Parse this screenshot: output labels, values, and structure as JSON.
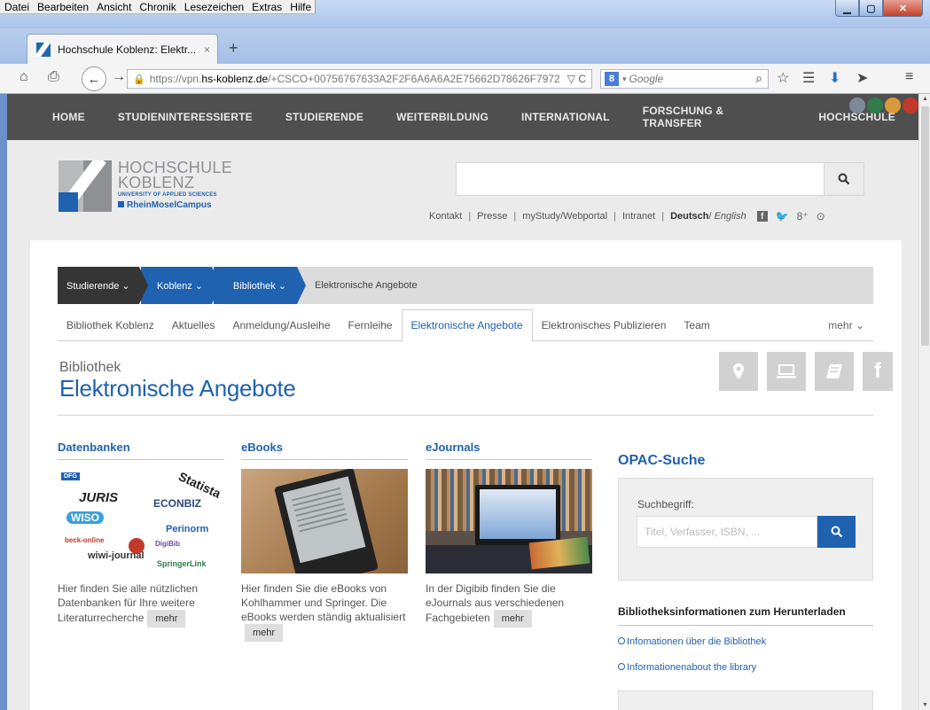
{
  "menubar": [
    "Datei",
    "Bearbeiten",
    "Ansicht",
    "Chronik",
    "Lesezeichen",
    "Extras",
    "Hilfe"
  ],
  "tab": {
    "title": "Hochschule Koblenz: Elektr...",
    "close": "×",
    "new": "+"
  },
  "address": {
    "lock": "🔒",
    "prefix": "https://vpn.",
    "domain": "hs-koblenz.de",
    "path": "/+CSCO+00756767633A2F2F6A6A6A2E75662D78626F7972",
    "reload": "▽ C"
  },
  "search_engine": {
    "badge": "8",
    "placeholder": "Google"
  },
  "topnav": [
    "HOME",
    "STUDIENINTERESSIERTE",
    "STUDIERENDE",
    "WEITERBILDUNG",
    "INTERNATIONAL",
    "FORSCHUNG & TRANSFER",
    "HOCHSCHULE"
  ],
  "logo": {
    "line1": "HOCHSCHULE",
    "line2": "KOBLENZ",
    "line3": "UNIVERSITY OF APPLIED SCIENCES",
    "line4": "RheinMoselCampus"
  },
  "utility": {
    "links": [
      "Kontakt",
      "Presse",
      "myStudy/Webportal",
      "Intranet"
    ],
    "deutsch": "Deutsch",
    "slash": " /",
    "english": "English",
    "fb": "f",
    "tw": "🐦",
    "gp": "8⁺",
    "yt": "⊙"
  },
  "breadcrumb": {
    "b0": "Studierende ⌄",
    "b1": "Koblenz ⌄",
    "b2": "Bibliothek ⌄",
    "current": "Elektronische Angebote"
  },
  "subtabs": [
    "Bibliothek Koblenz",
    "Aktuelles",
    "Anmeldung/Ausleihe",
    "Fernleihe",
    "Elektronische Angebote",
    "Elektronisches Publizieren",
    "Team"
  ],
  "subtabs_more": "mehr ⌄",
  "page": {
    "kicker": "Bibliothek",
    "title": "Elektronische Angebote"
  },
  "columns": [
    {
      "heading": "Datenbanken",
      "desc": "Hier finden Sie alle nützlichen Datenbanken für Ihre weitere Literaturrecherche",
      "more": "mehr"
    },
    {
      "heading": "eBooks",
      "desc": "Hier finden Sie die eBooks von Kohlhammer und Springer. Die eBooks werden ständig aktualisiert",
      "more": "mehr"
    },
    {
      "heading": "eJournals",
      "desc": "In der Digibib finden Sie die eJournals aus verschiedenen Fachgebieten",
      "more": "mehr"
    }
  ],
  "collage": {
    "juris": "JURIS",
    "econbiz": "ECONBIZ",
    "wiso": "WISO",
    "perinorm": "Perinorm",
    "beck": "beck-online",
    "wiwi": "wiwi-journal",
    "springer": "SpringerLink",
    "statista": "Statista",
    "digibib": "DigiBib",
    "dfg": "DFG"
  },
  "opac": {
    "title": "OPAC-Suche",
    "label": "Suchbegriff:",
    "placeholder": "Titel, Verfasser, ISBN, ..."
  },
  "downloads": {
    "title": "Bibliotheksinformationen zum Herunterladen",
    "link1": "Infomationen über die Bibliothek",
    "link2": "Informationenabout the library"
  },
  "colors": {
    "accent": "#1e62b0",
    "nav": "#4f4f4f",
    "dark_crumb": "#353535"
  }
}
